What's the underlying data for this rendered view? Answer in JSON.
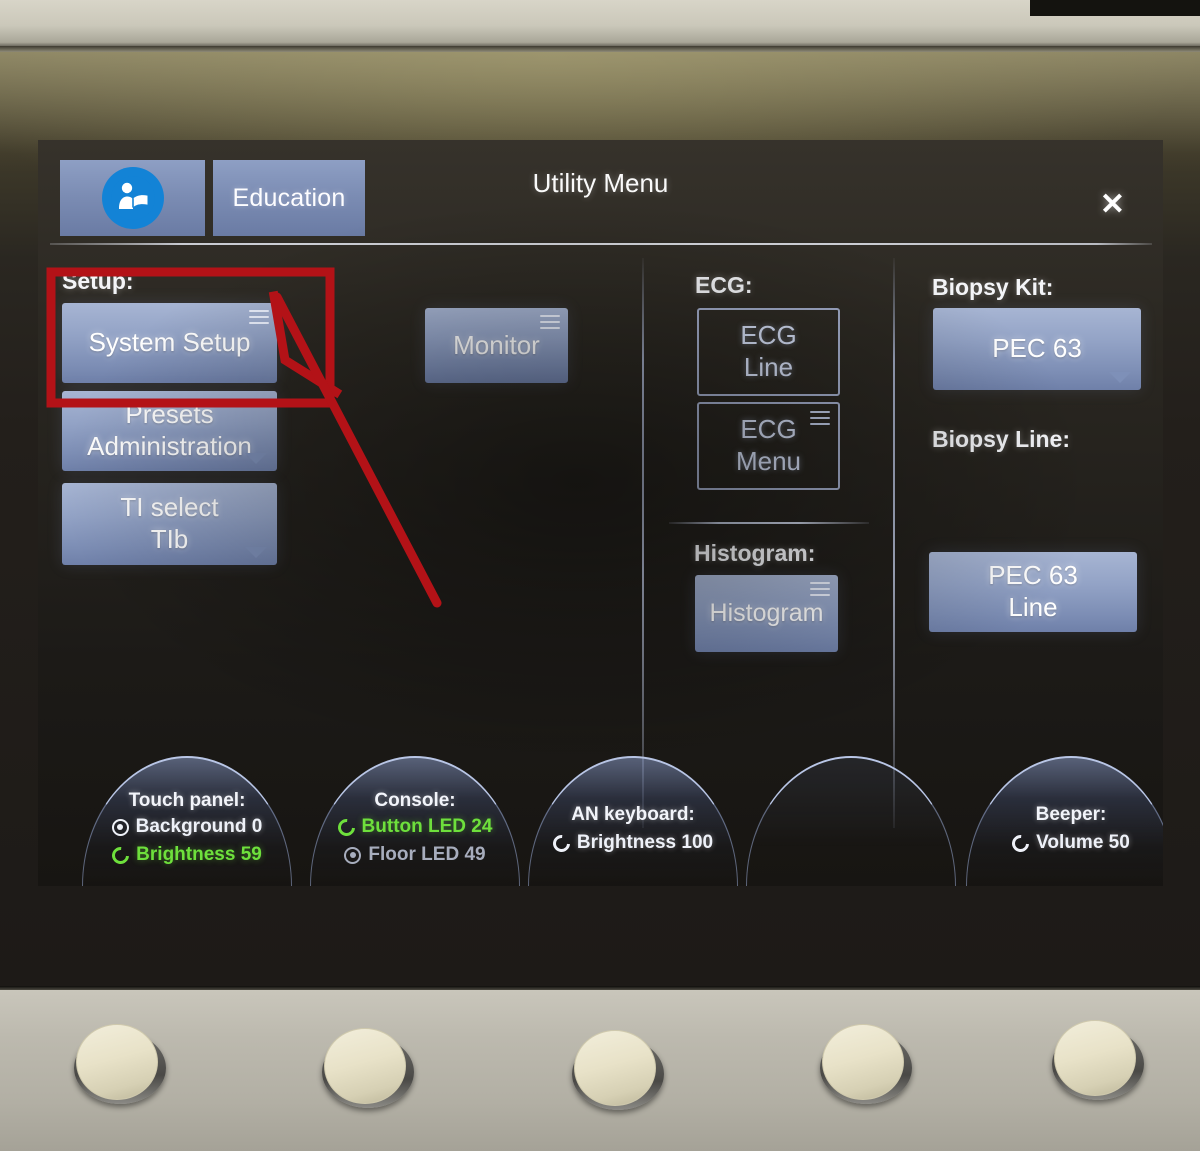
{
  "header": {
    "education_icon": "read-instructions-icon",
    "education_label": "Education",
    "title": "Utility Menu",
    "close_label": "✕"
  },
  "columns": {
    "setup": {
      "label": "Setup:",
      "buttons": [
        {
          "label_line1": "System Setup",
          "label_line2": "",
          "indicator": "hamburger-icon",
          "style": "filled"
        },
        {
          "label_line1": "Presets",
          "label_line2": "Administration",
          "indicator": "caret-down-icon",
          "style": "filled"
        },
        {
          "label_line1": "TI select",
          "label_line2": "TIb",
          "indicator": "caret-down-icon",
          "style": "filled"
        }
      ]
    },
    "monitor": {
      "buttons": [
        {
          "label_line1": "Monitor",
          "label_line2": "",
          "indicator": "hamburger-icon",
          "style": "filled"
        }
      ]
    },
    "ecg": {
      "label": "ECG:",
      "buttons": [
        {
          "label_line1": "ECG",
          "label_line2": "Line",
          "indicator": "none",
          "style": "outline"
        },
        {
          "label_line1": "ECG",
          "label_line2": "Menu",
          "indicator": "hamburger-icon",
          "style": "outline"
        }
      ],
      "histogram_label": "Histogram:",
      "histogram_buttons": [
        {
          "label_line1": "Histogram",
          "label_line2": "",
          "indicator": "hamburger-icon",
          "style": "filled"
        }
      ]
    },
    "biopsy": {
      "kit_label": "Biopsy Kit:",
      "kit_button": {
        "label_line1": "PEC 63",
        "label_line2": "",
        "indicator": "caret-down-icon",
        "style": "filled"
      },
      "line_label": "Biopsy Line:",
      "line_button": {
        "label_line1": "PEC 63",
        "label_line2": "Line",
        "indicator": "none",
        "style": "filled"
      }
    }
  },
  "status_arcs": [
    {
      "title": "Touch panel:",
      "rows": [
        {
          "icon": "press-dot-icon",
          "text": "Background 0",
          "tone": "white"
        },
        {
          "icon": "rotate-icon",
          "text": "Brightness 59",
          "tone": "green"
        }
      ]
    },
    {
      "title": "Console:",
      "rows": [
        {
          "icon": "rotate-icon",
          "text": "Button LED 24",
          "tone": "green"
        },
        {
          "icon": "press-dot-icon",
          "text": "Floor LED 49",
          "tone": "dim"
        }
      ]
    },
    {
      "title": "AN keyboard:",
      "rows": [
        {
          "icon": "rotate-icon",
          "text": "Brightness 100",
          "tone": "white"
        }
      ]
    },
    {
      "title": "",
      "rows": []
    },
    {
      "title": "Beeper:",
      "rows": [
        {
          "icon": "rotate-icon",
          "text": "Volume 50",
          "tone": "white"
        }
      ]
    }
  ],
  "annotation": {
    "type": "red-callout",
    "color": "#b31217",
    "target": "System Setup",
    "shapes": [
      "rectangle-highlight",
      "arrow-pointing-to-rectangle"
    ]
  },
  "device": {
    "knob_count": 5,
    "knob_name": "control-knob"
  }
}
